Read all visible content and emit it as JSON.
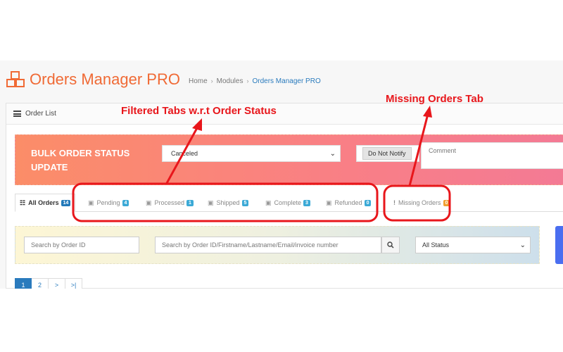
{
  "app": {
    "title": "Orders Manager PRO",
    "breadcrumb": [
      "Home",
      "Modules",
      "Orders Manager PRO"
    ]
  },
  "panel": {
    "title": "Order List"
  },
  "bulk": {
    "title": "BULK ORDER STATUS UPDATE",
    "status_value": "Canceled",
    "notify_label": "Do Not Notify",
    "comment_placeholder": "Comment"
  },
  "tabs": [
    {
      "label": "All Orders",
      "count": "14",
      "icon": "sitemap-icon"
    },
    {
      "label": "Pending",
      "count": "4",
      "icon": "box-icon"
    },
    {
      "label": "Processed",
      "count": "1",
      "icon": "box-icon"
    },
    {
      "label": "Shipped",
      "count": "5",
      "icon": "box-icon"
    },
    {
      "label": "Complete",
      "count": "3",
      "icon": "box-icon"
    },
    {
      "label": "Refunded",
      "count": "0",
      "icon": "box-icon"
    },
    {
      "label": "Missing Orders",
      "count": "0",
      "icon": "exclamation-icon"
    }
  ],
  "filters": {
    "order_id_placeholder": "Search by Order ID",
    "search_placeholder": "Search by Order ID/Firstname/Lastname/Email/invoice number",
    "status_value": "All Status"
  },
  "pagination": [
    "1",
    "2",
    ">",
    ">|"
  ],
  "annotations": {
    "filtered_tabs": "Filtered Tabs w.r.t Order Status",
    "missing_tab": "Missing Orders Tab"
  },
  "colors": {
    "accent": "#f06a35",
    "annotation": "#e8161b",
    "link": "#2a7bbd"
  }
}
